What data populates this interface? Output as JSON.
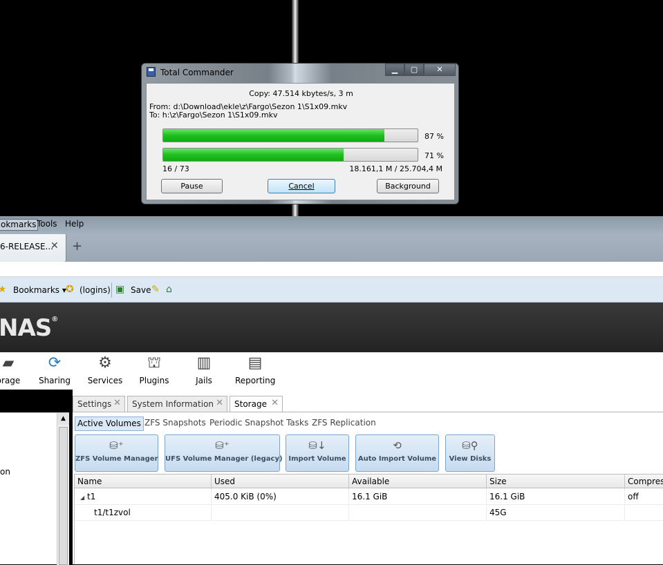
{
  "browser": {
    "menu": [
      "okmarks",
      "Tools",
      "Help"
    ],
    "tab_title": "6-RELEASE...",
    "tab_close": "✕",
    "new_tab": "+",
    "bookmarks_label": "Bookmarks",
    "logins_label": "(logins)",
    "save_label": "Save"
  },
  "freenas": {
    "logo": "NAS",
    "logo_mark": "®",
    "nav": [
      "orage",
      "Sharing",
      "Services",
      "Plugins",
      "Jails",
      "Reporting"
    ],
    "left_pane_text": "on",
    "tabs": [
      "Settings",
      "System Information",
      "Storage"
    ],
    "active_tab": "Storage",
    "subtabs": [
      "Active Volumes",
      "ZFS Snapshots",
      "Periodic Snapshot Tasks",
      "ZFS Replication"
    ],
    "buttons": [
      "ZFS Volume Manager",
      "UFS Volume Manager (legacy)",
      "Import Volume",
      "Auto Import Volume",
      "View Disks"
    ],
    "columns": [
      "Name",
      "Used",
      "Available",
      "Size",
      "Compress"
    ],
    "rows": [
      {
        "name": "t1",
        "used": "405.0 KiB (0%)",
        "available": "16.1 GiB",
        "size": "16.1 GiB",
        "compression": "off"
      },
      {
        "name": "t1/t1zvol",
        "used": "",
        "available": "",
        "size": "45G",
        "compression": ""
      }
    ]
  },
  "tc": {
    "title": "Total Commander",
    "copy": "Copy: 47.514 kbytes/s, 3 m",
    "from": "From: d:\\Download\\ekle\\z\\Fargo\\Sezon 1\\S1x09.mkv",
    "to": "To:  h:\\z\\Fargo\\Sezon 1\\S1x09.mkv",
    "progress1": 0.87,
    "progress1_label": "87 %",
    "progress2": 0.71,
    "progress2_label": "71 %",
    "files": "16 / 73",
    "bytes": "18.161,1 M / 25.704,4 M",
    "pause": "Pause",
    "cancel": "Cancel",
    "background": "Background"
  }
}
